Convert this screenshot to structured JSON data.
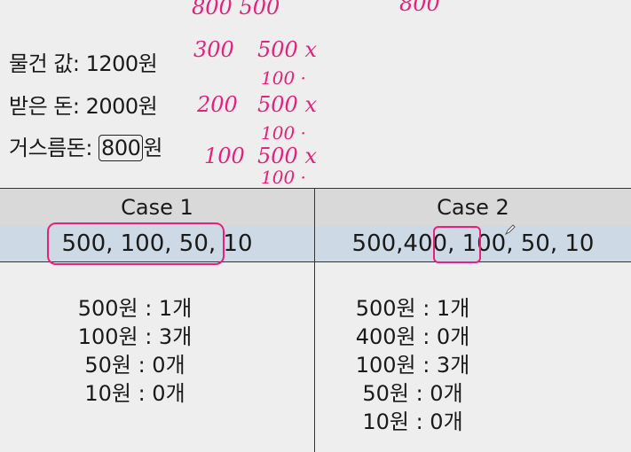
{
  "problem": {
    "price_label": "물건 값: 1200원",
    "paid_label": "받은 돈: 2000원",
    "change_label": "거스름돈: ",
    "change_value": "800",
    "change_unit": "원"
  },
  "handwriting": {
    "top_left": "800 500",
    "top_right": "800",
    "row1_a": "300",
    "row1_b": "500 x",
    "row1_c": "100 ·",
    "row2_a": "200",
    "row2_b": "500 x",
    "row2_c": "100 ·",
    "row3_a": "100",
    "row3_b": "500 x",
    "row3_c": "100 ·"
  },
  "table": {
    "case1": {
      "header": "Case 1",
      "coins": "500, 100, 50, 10",
      "counts": [
        "500원 : 1개",
        "100원 : 3개",
        "50원 : 0개",
        "10원 : 0개"
      ]
    },
    "case2": {
      "header": "Case 2",
      "coins_pre": "500, ",
      "coins_hl": "400",
      "coins_post": ", 100, 50, 10",
      "counts": [
        "500원 : 1개",
        "400원 : 0개",
        "100원 : 3개",
        "50원 : 0개",
        "10원 : 0개"
      ]
    }
  },
  "colors": {
    "annotation": "#e6227a",
    "header_bg": "#d9d9d9",
    "row_bg": "#cdd9e5"
  }
}
